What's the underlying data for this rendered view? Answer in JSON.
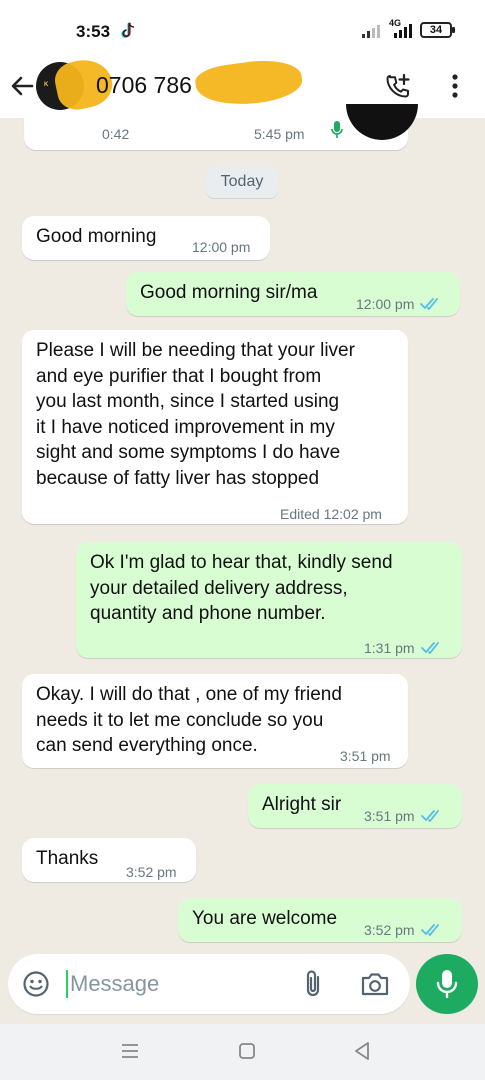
{
  "status_bar": {
    "time": "3:53",
    "network": "4G",
    "battery": "34"
  },
  "header": {
    "contact_name": "0706 786",
    "icons": [
      "back-arrow-icon",
      "add-call-icon",
      "more-vert-icon"
    ]
  },
  "audio_message": {
    "duration": "0:42",
    "time": "5:45 pm"
  },
  "date_chip": "Today",
  "messages": [
    {
      "direction": "in",
      "text": "Good morning",
      "meta": "12:00 pm"
    },
    {
      "direction": "out",
      "text": "Good morning sir/ma",
      "meta": "12:00 pm"
    },
    {
      "direction": "in",
      "text": "Please I will be needing that your liver\nand eye purifier that I bought from\nyou last month, since I started using\nit I have noticed improvement in my\nsight and some symptoms I do have\nbecause of fatty liver has stopped",
      "meta": "Edited 12:02 pm"
    },
    {
      "direction": "out",
      "text": "Ok I'm glad to hear that, kindly send\nyour detailed delivery address,\nquantity and phone number.",
      "meta": "1:31 pm"
    },
    {
      "direction": "in",
      "text": "Okay. I will do that , one of my friend\nneeds it to let me conclude so you\ncan send everything once.",
      "meta": "3:51 pm"
    },
    {
      "direction": "out",
      "text": "Alright sir",
      "meta": "3:51 pm"
    },
    {
      "direction": "in",
      "text": "Thanks",
      "meta": "3:52 pm"
    },
    {
      "direction": "out",
      "text": "You are welcome",
      "meta": "3:52 pm"
    }
  ],
  "composer": {
    "placeholder": "Message"
  },
  "colors": {
    "chat_background": "#efeae2",
    "incoming_bubble": "#ffffff",
    "outgoing_bubble": "#d9fdd3",
    "read_ticks": "#53bdeb",
    "accent": "#1daa61"
  }
}
